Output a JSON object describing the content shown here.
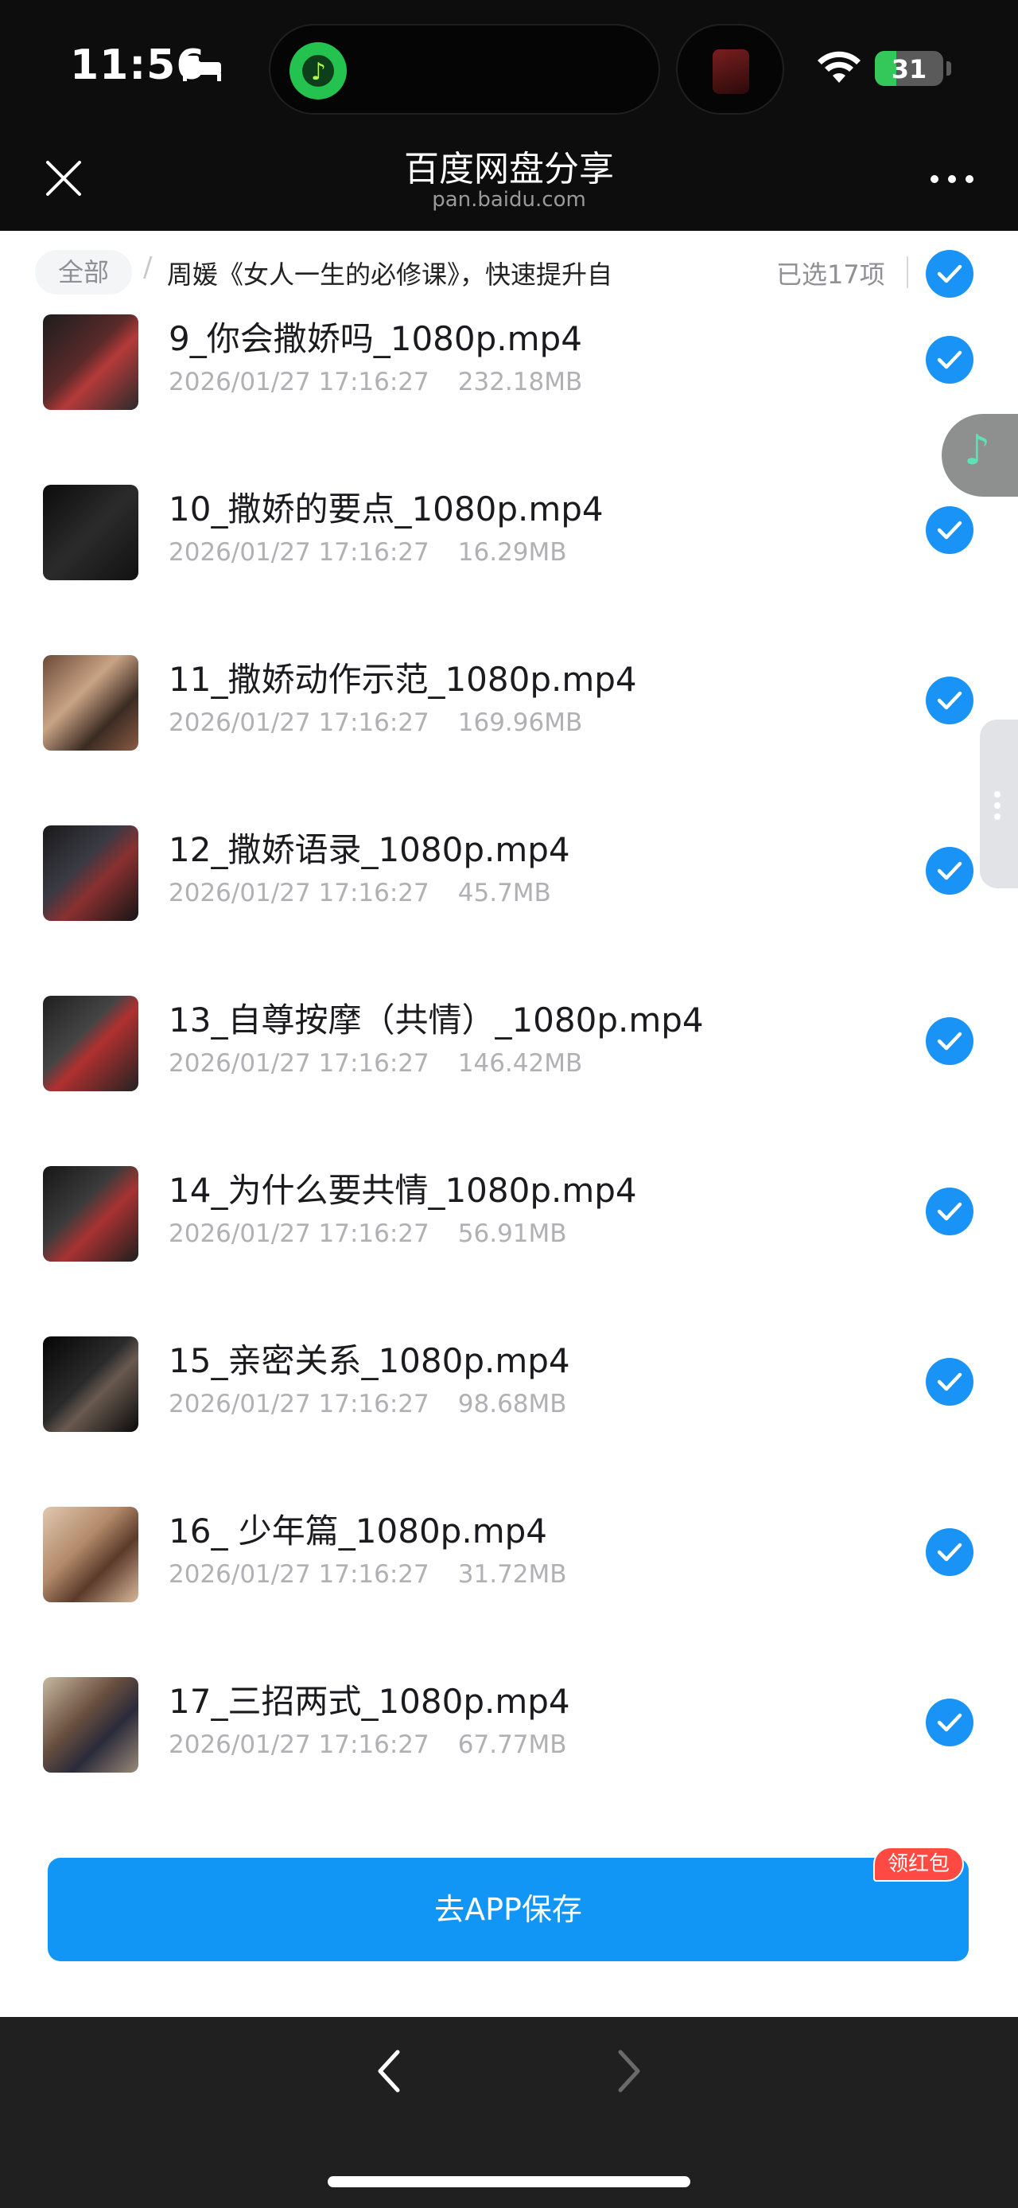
{
  "status_bar": {
    "time": "11:56",
    "battery_percent": "31",
    "battery_level": 0.31
  },
  "nav": {
    "title": "百度网盘分享",
    "subtitle": "pan.baidu.com"
  },
  "breadcrumb": {
    "root_label": "全部",
    "separator": "/",
    "folder_name": "周媛《女人一生的必修课》，快速提升自",
    "selected_count": "已选17项"
  },
  "files": [
    {
      "name": "9_你会撒娇吗_1080p.mp4",
      "date": "2026/01/27 17:16:27",
      "size": "232.18MB",
      "checked": true
    },
    {
      "name": "10_撒娇的要点_1080p.mp4",
      "date": "2026/01/27 17:16:27",
      "size": "16.29MB",
      "checked": true
    },
    {
      "name": "11_撒娇动作示范_1080p.mp4",
      "date": "2026/01/27 17:16:27",
      "size": "169.96MB",
      "checked": true
    },
    {
      "name": "12_撒娇语录_1080p.mp4",
      "date": "2026/01/27 17:16:27",
      "size": "45.7MB",
      "checked": true
    },
    {
      "name": "13_自尊按摩（共情）_1080p.mp4",
      "date": "2026/01/27 17:16:27",
      "size": "146.42MB",
      "checked": true
    },
    {
      "name": "14_为什么要共情_1080p.mp4",
      "date": "2026/01/27 17:16:27",
      "size": "56.91MB",
      "checked": true
    },
    {
      "name": "15_亲密关系_1080p.mp4",
      "date": "2026/01/27 17:16:27",
      "size": "98.68MB",
      "checked": true
    },
    {
      "name": "16_ 少年篇_1080p.mp4",
      "date": "2026/01/27 17:16:27",
      "size": "31.72MB",
      "checked": true
    },
    {
      "name": "17_三招两式_1080p.mp4",
      "date": "2026/01/27 17:16:27",
      "size": "67.77MB",
      "checked": true
    }
  ],
  "actions": {
    "save_label": "去APP保存",
    "redpack_badge": "领红包"
  },
  "colors": {
    "accent": "#1a93f6",
    "save_button": "#1296f5",
    "badge": "#ff4a43",
    "chrome": "#0d0d0d"
  }
}
